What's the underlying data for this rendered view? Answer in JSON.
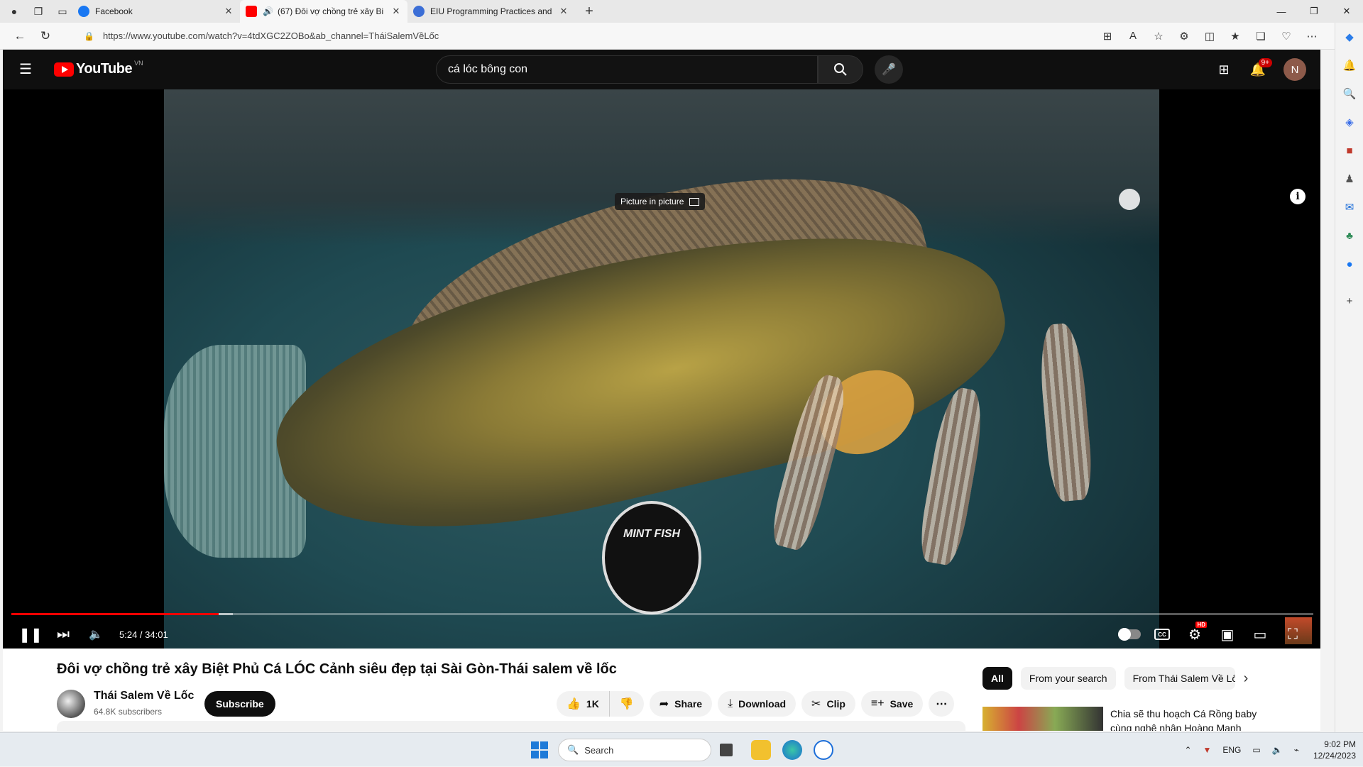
{
  "browser": {
    "tabs": [
      {
        "title": "Facebook",
        "favicon_color": "#1877f2"
      },
      {
        "title": "(67) Đôi vợ chồng trẻ xây Bi",
        "favicon_color": "#ff0000"
      },
      {
        "title": "EIU Programming Practices and",
        "favicon_color": "#3b6ed6"
      }
    ],
    "new_tab": "+",
    "url": "https://www.youtube.com/watch?v=4tdXGC2ZOBo&ab_channel=TháiSalemVềLốc"
  },
  "youtube": {
    "logo_text": "YouTube",
    "country": "VN",
    "search_value": "cá lóc bông con",
    "notification_badge": "9+",
    "avatar_letter": "N"
  },
  "player": {
    "pip_tooltip": "Picture in picture",
    "watermark": "MINT FISH",
    "time": "5:24 / 34:01",
    "progress_played": 0.159,
    "progress_loaded": 0.17,
    "cc_label": "CC",
    "hd_label": "HD"
  },
  "video": {
    "title": "Đôi vợ chồng trẻ xây Biệt Phủ Cá LÓC Cảnh siêu đẹp tại Sài Gòn-Thái salem về lốc",
    "channel": "Thái Salem Về Lốc",
    "subscribers": "64.8K subscribers",
    "subscribe_label": "Subscribe",
    "likes": "1K",
    "share": "Share",
    "download": "Download",
    "clip": "Clip",
    "save": "Save"
  },
  "sidebar_chips": [
    "All",
    "From your search",
    "From Thái Salem Về Lốc"
  ],
  "recommendation": {
    "title": "Chia sẽ thu hoạch Cá Rồng baby cùng nghệ nhân Hoàng Mạnh"
  },
  "taskbar": {
    "search_placeholder": "Search",
    "language": "ENG",
    "time": "9:02 PM",
    "date": "12/24/2023"
  }
}
